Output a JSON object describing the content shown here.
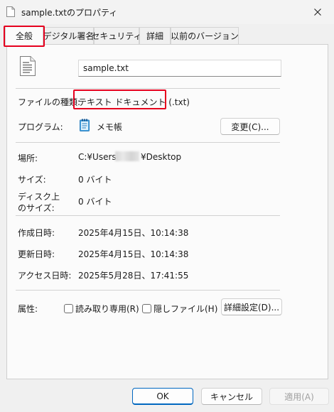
{
  "window": {
    "title": "sample.txtのプロパティ"
  },
  "tabs": [
    {
      "label": "全般"
    },
    {
      "label": "デジタル署名"
    },
    {
      "label": "セキュリティ"
    },
    {
      "label": "詳細"
    },
    {
      "label": "以前のバージョン"
    }
  ],
  "general": {
    "file_name": "sample.txt",
    "file_type_label": "ファイルの種類:",
    "file_type_value": "テキスト ドキュメント (.txt)",
    "program_label": "プログラム:",
    "program_value": "メモ帳",
    "change_button": "変更(C)...",
    "location_label": "場所:",
    "location_prefix": "C:¥Users¥",
    "location_suffix": "¥Desktop",
    "size_label": "サイズ:",
    "size_value": "0 バイト",
    "disk_size_label_line1": "ディスク上",
    "disk_size_label_line2": "のサイズ:",
    "disk_size_value": "0 バイト",
    "created_label": "作成日時:",
    "created_value": "2025年4月15日、10:14:38",
    "modified_label": "更新日時:",
    "modified_value": "2025年4月15日、10:14:38",
    "accessed_label": "アクセス日時:",
    "accessed_value": "2025年5月28日、17:41:55",
    "attributes_label": "属性:",
    "readonly_label": "読み取り専用(R)",
    "hidden_label": "隠しファイル(H)",
    "advanced_button": "詳細設定(D)..."
  },
  "footer": {
    "ok": "OK",
    "cancel": "キャンセル",
    "apply": "適用(A)"
  },
  "colors": {
    "highlight": "#e6001e",
    "accent": "#0067c0"
  },
  "icons": [
    "document-icon",
    "close-icon",
    "text-file-icon",
    "notepad-icon"
  ]
}
